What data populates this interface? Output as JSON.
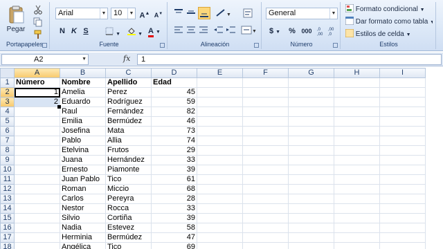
{
  "ribbon": {
    "clipboard": {
      "label": "Portapapeles",
      "paste_label": "Pegar"
    },
    "font": {
      "label": "Fuente",
      "font_name": "Arial",
      "font_size": "10",
      "bold": "N",
      "italic": "K",
      "underline": "S",
      "grow": "A",
      "shrink": "A",
      "font_color": "A"
    },
    "alignment": {
      "label": "Alineación"
    },
    "number": {
      "label": "Número",
      "format": "General",
      "currency": "$",
      "percent": "%",
      "thousands": "000"
    },
    "styles": {
      "label": "Estilos",
      "conditional": "Formato condicional",
      "as_table": "Dar formato como tabla",
      "cell_styles": "Estilos de celda"
    }
  },
  "formula_bar": {
    "name_box": "A2",
    "fx": "fx",
    "formula": "1"
  },
  "columns": [
    "A",
    "B",
    "C",
    "D",
    "E",
    "F",
    "G",
    "H",
    "I"
  ],
  "rows": [
    {
      "n": "1",
      "a": "Número",
      "b": "Nombre",
      "c": "Apellido",
      "d": "Edad"
    },
    {
      "n": "2",
      "a": "1",
      "b": "Amelia",
      "c": "Perez",
      "d": "45"
    },
    {
      "n": "3",
      "a": "2",
      "b": "Eduardo",
      "c": "Rodríguez",
      "d": "59"
    },
    {
      "n": "4",
      "a": "",
      "b": "Raul",
      "c": "Fernández",
      "d": "82"
    },
    {
      "n": "5",
      "a": "",
      "b": "Emilia",
      "c": "Bermúdez",
      "d": "46"
    },
    {
      "n": "6",
      "a": "",
      "b": "Josefina",
      "c": "Mata",
      "d": "73"
    },
    {
      "n": "7",
      "a": "",
      "b": "Pablo",
      "c": "Allia",
      "d": "74"
    },
    {
      "n": "8",
      "a": "",
      "b": "Etelvina",
      "c": "Frutos",
      "d": "29"
    },
    {
      "n": "9",
      "a": "",
      "b": "Juana",
      "c": "Hernández",
      "d": "33"
    },
    {
      "n": "10",
      "a": "",
      "b": "Ernesto",
      "c": "Piamonte",
      "d": "39"
    },
    {
      "n": "11",
      "a": "",
      "b": "Juan Pablo",
      "c": "Tico",
      "d": "61"
    },
    {
      "n": "12",
      "a": "",
      "b": "Roman",
      "c": "Miccio",
      "d": "68"
    },
    {
      "n": "13",
      "a": "",
      "b": "Carlos",
      "c": "Pereyra",
      "d": "28"
    },
    {
      "n": "14",
      "a": "",
      "b": "Nestor",
      "c": "Rocca",
      "d": "33"
    },
    {
      "n": "15",
      "a": "",
      "b": "Silvio",
      "c": "Cortiña",
      "d": "39"
    },
    {
      "n": "16",
      "a": "",
      "b": "Nadia",
      "c": "Estevez",
      "d": "58"
    },
    {
      "n": "17",
      "a": "",
      "b": "Herminia",
      "c": "Bermúdez",
      "d": "47"
    },
    {
      "n": "18",
      "a": "",
      "b": "Angélica",
      "c": "Tico",
      "d": "69"
    }
  ],
  "colors": {
    "selection": "#d8e4f4",
    "header_selected": "#f8c96b",
    "ribbon": "#dde9f8"
  }
}
